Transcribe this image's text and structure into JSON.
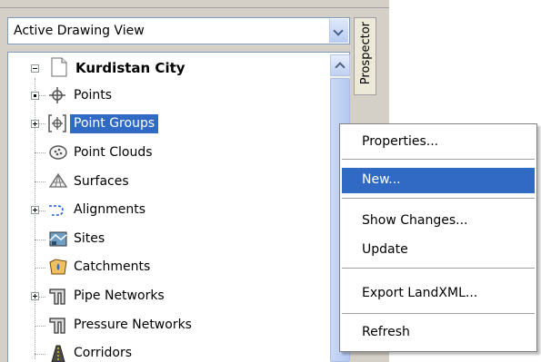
{
  "combo": {
    "value": "Active Drawing View"
  },
  "prospector_tab": {
    "label": "Prospector"
  },
  "tree": {
    "root": {
      "label": "Kurdistan City"
    },
    "items": [
      {
        "label": "Points",
        "icon": "points-icon"
      },
      {
        "label": "Point Groups",
        "icon": "point-groups-icon",
        "selected": true
      },
      {
        "label": "Point Clouds",
        "icon": "point-clouds-icon"
      },
      {
        "label": "Surfaces",
        "icon": "surfaces-icon"
      },
      {
        "label": "Alignments",
        "icon": "alignments-icon"
      },
      {
        "label": "Sites",
        "icon": "sites-icon"
      },
      {
        "label": "Catchments",
        "icon": "catchments-icon"
      },
      {
        "label": "Pipe Networks",
        "icon": "pipe-networks-icon"
      },
      {
        "label": "Pressure Networks",
        "icon": "pressure-networks-icon"
      },
      {
        "label": "Corridors",
        "icon": "corridors-icon"
      }
    ]
  },
  "context_menu": {
    "items": [
      {
        "label": "Properties..."
      },
      {
        "label": "New...",
        "highlighted": true
      },
      {
        "label": "Show Changes..."
      },
      {
        "label": "Update"
      },
      {
        "label": "Export LandXML..."
      },
      {
        "label": "Refresh"
      }
    ]
  },
  "colors": {
    "selection": "#316ac5",
    "panel": "#d4d0c8",
    "border": "#7f9db9"
  }
}
